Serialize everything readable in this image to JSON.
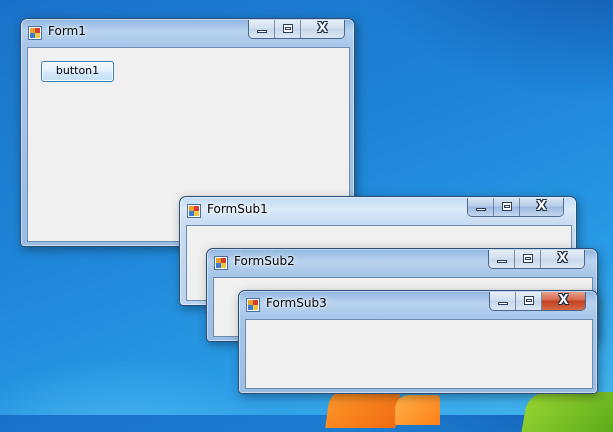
{
  "windows": {
    "form1": {
      "title": "Form1",
      "button_label": "button1"
    },
    "formsub1": {
      "title": "FormSub1"
    },
    "formsub2": {
      "title": "FormSub2"
    },
    "formsub3": {
      "title": "FormSub3"
    }
  },
  "caption_buttons": {
    "close_glyph": "X"
  },
  "icons": {
    "app": "winforms-app-icon",
    "minimize": "minimize-icon",
    "maximize": "maximize-icon",
    "close": "close-icon"
  },
  "colors": {
    "desktop": "#1f86d8",
    "client": "#f0f0f0",
    "close_hover": "#c2411f"
  }
}
